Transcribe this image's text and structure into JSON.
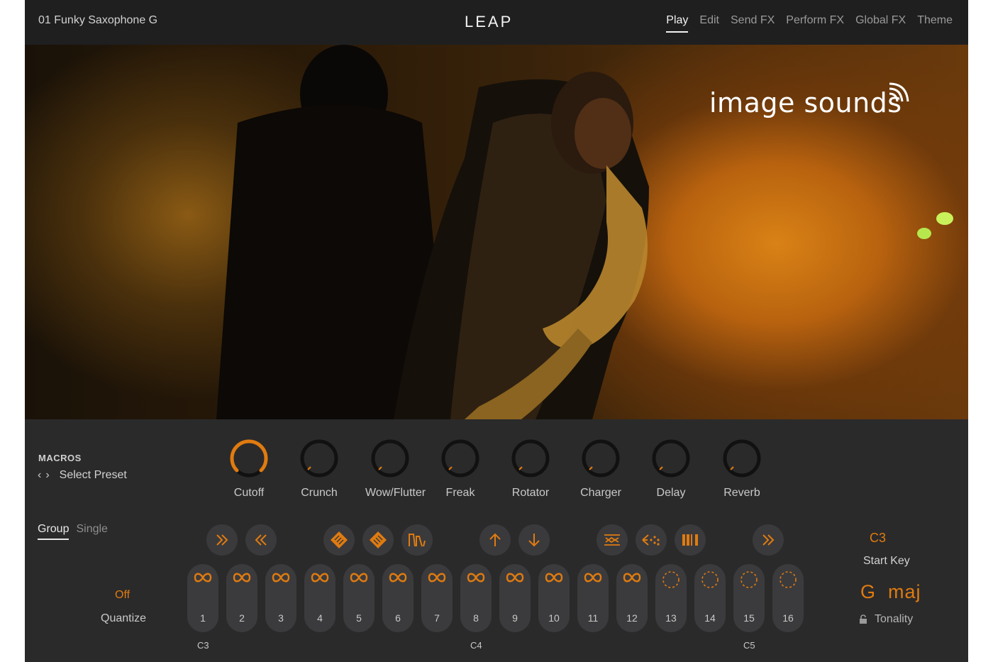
{
  "header": {
    "preset_name": "01 Funky Saxophone G",
    "logo": "LEAP",
    "tabs": [
      {
        "label": "Play",
        "active": true
      },
      {
        "label": "Edit",
        "active": false
      },
      {
        "label": "Send FX",
        "active": false
      },
      {
        "label": "Perform FX",
        "active": false
      },
      {
        "label": "Global FX",
        "active": false
      },
      {
        "label": "Theme",
        "active": false
      }
    ]
  },
  "hero": {
    "brand": "image sounds"
  },
  "macros": {
    "title": "MACROS",
    "prev_icon": "chevron-left-icon",
    "next_icon": "chevron-right-icon",
    "select_preset": "Select Preset",
    "knobs": [
      {
        "label": "Cutoff",
        "value": 0.9
      },
      {
        "label": "Crunch",
        "value": 0.0
      },
      {
        "label": "Wow/Flutter",
        "value": 0.0
      },
      {
        "label": "Freak",
        "value": 0.0
      },
      {
        "label": "Rotator",
        "value": 0.0
      },
      {
        "label": "Charger",
        "value": 0.0
      },
      {
        "label": "Delay",
        "value": 0.0
      },
      {
        "label": "Reverb",
        "value": 0.0
      }
    ]
  },
  "mode_tabs": [
    {
      "label": "Group",
      "active": true
    },
    {
      "label": "Single",
      "active": false
    }
  ],
  "quantize": {
    "value": "Off",
    "label": "Quantize"
  },
  "perform_buttons": [
    {
      "icon": "fast-forward-icon"
    },
    {
      "icon": "rewind-icon"
    },
    {
      "icon": "grid-diamond-icon"
    },
    {
      "icon": "grid-diamond-alt-icon"
    },
    {
      "icon": "wave-shape-icon"
    },
    {
      "icon": "arrow-up-icon"
    },
    {
      "icon": "arrow-down-icon"
    },
    {
      "icon": "reverse-arrows-icon"
    },
    {
      "icon": "scatter-arrow-icon"
    },
    {
      "icon": "slices-icon"
    },
    {
      "icon": "fast-forward-icon"
    }
  ],
  "pads": [
    {
      "num": "1",
      "state": "loop"
    },
    {
      "num": "2",
      "state": "loop"
    },
    {
      "num": "3",
      "state": "loop"
    },
    {
      "num": "4",
      "state": "loop"
    },
    {
      "num": "5",
      "state": "loop"
    },
    {
      "num": "6",
      "state": "loop"
    },
    {
      "num": "7",
      "state": "loop"
    },
    {
      "num": "8",
      "state": "loop"
    },
    {
      "num": "9",
      "state": "loop"
    },
    {
      "num": "10",
      "state": "loop"
    },
    {
      "num": "11",
      "state": "loop"
    },
    {
      "num": "12",
      "state": "loop"
    },
    {
      "num": "13",
      "state": "empty"
    },
    {
      "num": "14",
      "state": "empty"
    },
    {
      "num": "15",
      "state": "empty"
    },
    {
      "num": "16",
      "state": "empty"
    }
  ],
  "key_labels": [
    "C3",
    "C4",
    "C5"
  ],
  "start_key": {
    "value": "C3",
    "label": "Start Key"
  },
  "tonality": {
    "value": "G  maj",
    "label": "Tonality"
  },
  "colors": {
    "accent": "#e07b10",
    "panel": "#2a2a2b",
    "header": "#1f1f20",
    "pad": "#3b3b3d"
  }
}
